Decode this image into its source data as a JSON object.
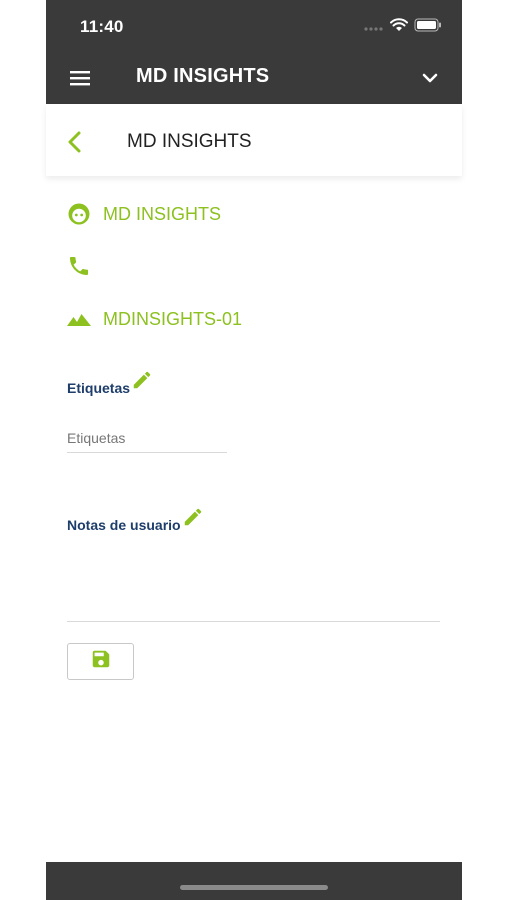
{
  "status_bar": {
    "time": "11:40",
    "icons": [
      "signal-dots-icon",
      "wifi-icon",
      "battery-icon"
    ]
  },
  "app_bar": {
    "title": "MD INSIGHTS",
    "menu_icon": "menu-icon",
    "dropdown_icon": "chevron-down-icon"
  },
  "sub_header": {
    "back_icon": "back-arrow-icon",
    "title": "MD INSIGHTS"
  },
  "details": {
    "name": "MD INSIGHTS",
    "phone": "",
    "site": "MDINSIGHTS-01",
    "icons": [
      "face-icon",
      "phone-icon",
      "terrain-icon"
    ]
  },
  "tags": {
    "label": "Etiquetas",
    "placeholder": "Etiquetas",
    "value": ""
  },
  "notes": {
    "label": "Notas de usuario",
    "value": ""
  },
  "save_button": {
    "icon": "save-icon"
  },
  "colors": {
    "bar": "#3a3a3a",
    "accent": "#8cc11f",
    "label": "#1d3d6b"
  }
}
